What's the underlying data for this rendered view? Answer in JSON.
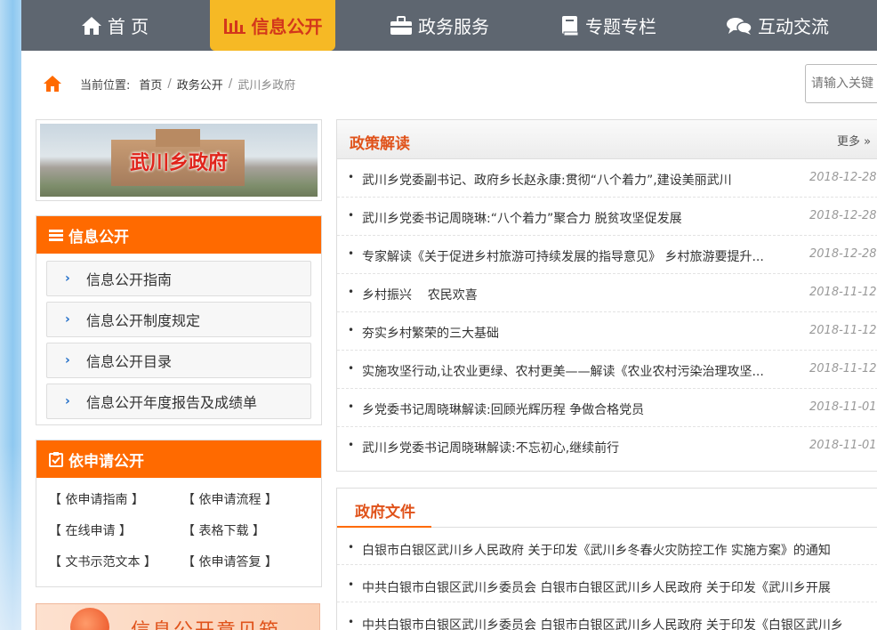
{
  "nav": {
    "items": [
      {
        "label": "首 页",
        "icon": "home-icon"
      },
      {
        "label": "信息公开",
        "icon": "bar-chart-icon",
        "active": true
      },
      {
        "label": "政务服务",
        "icon": "briefcase-icon"
      },
      {
        "label": "专题专栏",
        "icon": "book-icon"
      },
      {
        "label": "互动交流",
        "icon": "chat-icon"
      }
    ]
  },
  "breadcrumb": {
    "prefix": "当前位置:",
    "home": "首页",
    "sep": "/",
    "level1": "政务公开",
    "current": "武川乡政府"
  },
  "search": {
    "placeholder": "请输入关键"
  },
  "banner": {
    "title": "武川乡政府"
  },
  "info_panel": {
    "title": "信息公开",
    "links": [
      "信息公开指南",
      "信息公开制度规定",
      "信息公开目录",
      "信息公开年度报告及成绩单"
    ]
  },
  "apply_panel": {
    "title": "依申请公开",
    "links": [
      "【 依申请指南 】",
      "【 依申请流程 】",
      "【 在线申请 】",
      "【 表格下载 】",
      "【 文书示范文本 】",
      "【 依申请答复 】"
    ]
  },
  "feedback_banner": {
    "label": "信息公开意见箱"
  },
  "policy": {
    "title": "政策解读",
    "more": "更多 »",
    "items": [
      {
        "title": "武川乡党委副书记、政府乡长赵永康:贯彻“八个着力”,建设美丽武川",
        "date": "2018-12-28"
      },
      {
        "title": "武川乡党委书记周晓琳:“八个着力”聚合力 脱贫攻坚促发展",
        "date": "2018-12-28"
      },
      {
        "title": "专家解读《关于促进乡村旅游可持续发展的指导意见》 乡村旅游要提升...",
        "date": "2018-12-28"
      },
      {
        "title": "乡村振兴    农民欢喜",
        "date": "2018-11-12"
      },
      {
        "title": "夯实乡村繁荣的三大基础",
        "date": "2018-11-12"
      },
      {
        "title": "实施攻坚行动,让农业更绿、农村更美——解读《农业农村污染治理攻坚...",
        "date": "2018-11-12"
      },
      {
        "title": "乡党委书记周晓琳解读:回顾光辉历程 争做合格党员",
        "date": "2018-11-01"
      },
      {
        "title": "武川乡党委书记周晓琳解读:不忘初心,继续前行",
        "date": "2018-11-01"
      }
    ]
  },
  "docs": {
    "title": "政府文件",
    "items": [
      "白银市白银区武川乡人民政府 关于印发《武川乡冬春火灾防控工作 实施方案》的通知",
      "中共白银市白银区武川乡委员会 白银市白银区武川乡人民政府 关于印发《武川乡开展",
      "中共白银市白银区武川乡委员会 白银市白银区武川乡人民政府 关于印发《白银区武川乡"
    ]
  }
}
